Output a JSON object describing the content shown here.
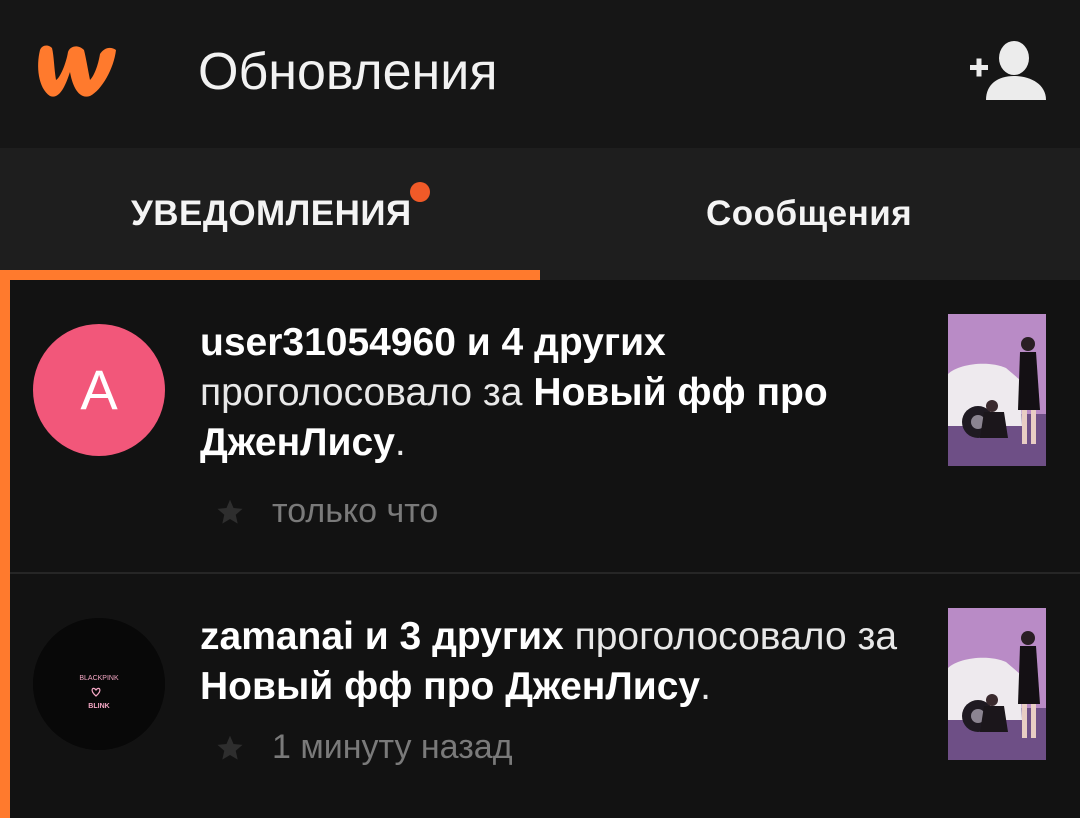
{
  "header": {
    "title": "Обновления",
    "logo_icon": "wattpad-logo-icon",
    "action_icon": "add-friend-icon",
    "accent_color": "#ff7a2d"
  },
  "tabs": [
    {
      "label": "УВЕДОМЛЕНИЯ",
      "active": true,
      "has_unread_dot": true
    },
    {
      "label": "Сообщения",
      "active": false,
      "has_unread_dot": false
    }
  ],
  "notifications": [
    {
      "avatar_letter": "A",
      "avatar_color": "#f2577a",
      "actor": "user31054960 и 4 других",
      "action": "проголосовало за",
      "story": "Новый фф про ДженЛису",
      "end": ".",
      "time": "только что",
      "icon": "star-icon",
      "unread": true
    },
    {
      "avatar_text_top": "BLACKPINK",
      "avatar_text_bottom": "BLINK",
      "avatar_icon": "heart-outline-icon",
      "actor": "zamanai и 3 других",
      "action": "проголосовало за",
      "story": "Новый фф про ДженЛису",
      "end": ".",
      "time": "1 минуту назад",
      "icon": "star-icon",
      "unread": true
    }
  ]
}
